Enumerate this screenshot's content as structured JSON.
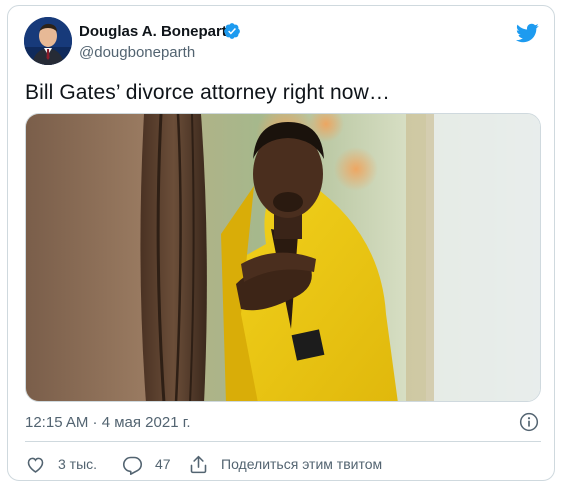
{
  "author": {
    "name": "Douglas A. Boneparth",
    "handle": "@dougboneparth"
  },
  "tweet": {
    "text": "Bill Gates’ divorce attorney right now…",
    "timestamp": "12:15 AM · 4 мая 2021 г."
  },
  "actions": {
    "likes": "3 тыс.",
    "replies": "47",
    "share_label": "Поделиться этим твитом"
  },
  "icons": {
    "verified": "verified-badge-icon",
    "brand": "twitter-bird-icon",
    "info": "info-icon",
    "like": "heart-icon",
    "reply": "reply-icon",
    "share": "share-icon"
  },
  "colors": {
    "twitter_blue": "#1d9bf0",
    "text_primary": "#0f1419",
    "text_secondary": "#536471",
    "border": "#cfd9de"
  }
}
